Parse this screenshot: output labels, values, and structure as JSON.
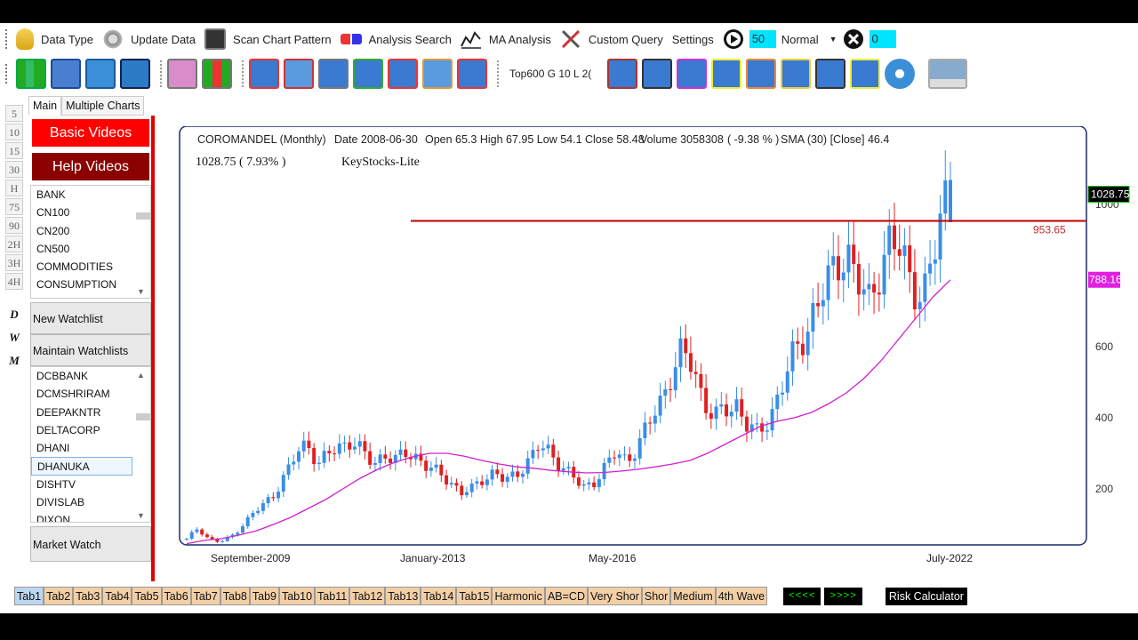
{
  "menu": {
    "data_type": "Data Type",
    "update_data": "Update Data",
    "scan_chart_pattern": "Scan Chart Pattern",
    "analysis_search": "Analysis Search",
    "ma_analysis": "MA Analysis",
    "custom_query": "Custom Query",
    "settings": "Settings",
    "speed_value": "50",
    "speed_mode": "Normal",
    "counter_value": "0"
  },
  "toolbar": {
    "combo_value": "Top600 G 10 L 2("
  },
  "left_numbers": [
    "5",
    "10",
    "15",
    "30",
    "H",
    "75",
    "90",
    "2H",
    "3H",
    "4H"
  ],
  "left_letters": [
    "D",
    "W",
    "M"
  ],
  "tabs": [
    "Main",
    "Multiple Charts"
  ],
  "buttons": {
    "basic_videos": "Basic Videos",
    "help_videos": "Help Videos",
    "new_watchlist": "New Watchlist",
    "maintain_watchlists": "Maintain Watchlists",
    "market_watch": "Market Watch"
  },
  "sector_list": [
    "BANK",
    "CN100",
    "CN200",
    "CN500",
    "COMMODITIES",
    "CONSUMPTION"
  ],
  "stock_list": [
    "DCBBANK",
    "DCMSHRIRAM",
    "DEEPAKNTR",
    "DELTACORP",
    "DHANI",
    "DHANUKA",
    "DISHTV",
    "DIVISLAB",
    "DIXON"
  ],
  "chart_header": {
    "symbol": "COROMANDEL  (Monthly)",
    "date": "Date  2008-06-30",
    "ohlc": "Open  65.3 High 67.95 Low 54.1 Close 58.48",
    "volume": "Volume 3058308",
    "change": "( -9.38 % )",
    "sma": "SMA (30) [Close]  46.4",
    "last": "1028.75 ( 7.93% )",
    "brand": "KeyStocks-Lite"
  },
  "chart_data": {
    "type": "candlestick",
    "x_labels": [
      "September-2009",
      "January-2013",
      "May-2016",
      "July-2022"
    ],
    "y_ticks": [
      200,
      400,
      600,
      1000
    ],
    "ylim": [
      50,
      1120
    ],
    "price_label": "1028.75",
    "sma_label": "788.16",
    "hline_label": "953.65",
    "hline": 953.65,
    "last_price": 1028.75,
    "sma_last": 788.16,
    "close_path": [
      58,
      90,
      60,
      50,
      65,
      95,
      130,
      155,
      190,
      240,
      300,
      330,
      270,
      300,
      320,
      340,
      300,
      270,
      300,
      280,
      300,
      290,
      260,
      240,
      220,
      190,
      200,
      230,
      250,
      220,
      240,
      280,
      320,
      300,
      270,
      240,
      200,
      220,
      260,
      300,
      280,
      320,
      380,
      440,
      520,
      580,
      550,
      450,
      400,
      420,
      440,
      380,
      350,
      400,
      480,
      560,
      620,
      700,
      760,
      820,
      880,
      780,
      720,
      820,
      900,
      860,
      780,
      740,
      860,
      1028
    ],
    "sma_path": [
      46,
      55,
      60,
      70,
      82,
      100,
      120,
      145,
      170,
      200,
      230,
      255,
      275,
      290,
      300,
      300,
      292,
      280,
      270,
      262,
      258,
      252,
      248,
      245,
      246,
      250,
      255,
      262,
      270,
      280,
      300,
      325,
      350,
      375,
      390,
      400,
      415,
      440,
      470,
      510,
      560,
      620,
      680,
      740,
      788
    ]
  }
}
